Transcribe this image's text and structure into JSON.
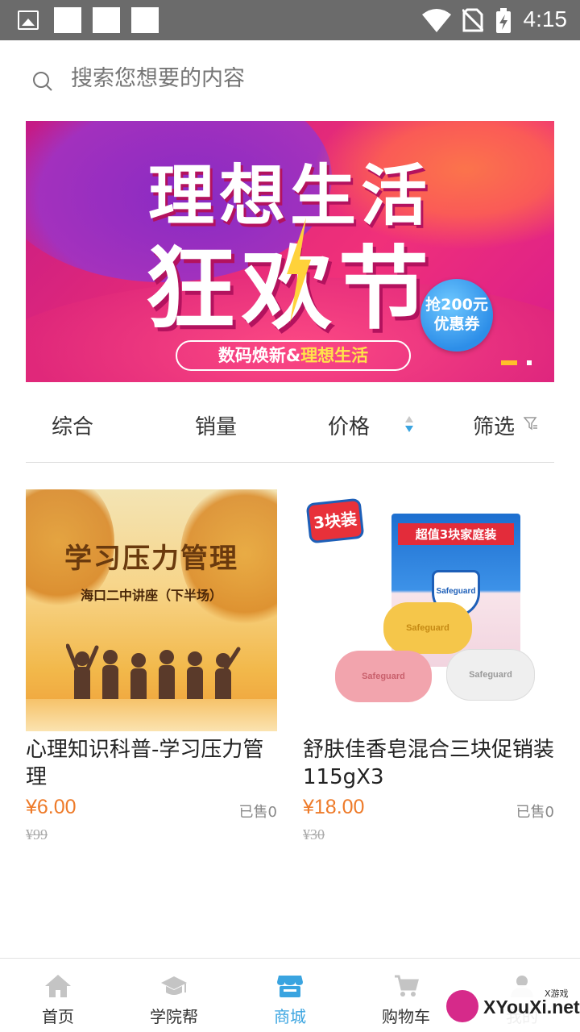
{
  "status_bar": {
    "time": "4:15"
  },
  "search": {
    "placeholder": "搜索您想要的内容"
  },
  "banner": {
    "title_line1": "理想生活",
    "title_line2": "狂欢节",
    "coupon": "抢200元 优惠券",
    "subtitle_prefix": "数码焕新&",
    "subtitle_highlight": "理想生活"
  },
  "sort": {
    "items": [
      {
        "label": "综合"
      },
      {
        "label": "销量"
      },
      {
        "label": "价格"
      },
      {
        "label": "筛选"
      }
    ]
  },
  "products": [
    {
      "image_title": "学习压力管理",
      "image_subtitle": "海口二中讲座（下半场）",
      "name": "心理知识科普-学习压力管理",
      "price": "¥6.00",
      "sold": "已售0",
      "original_price": "¥99"
    },
    {
      "image_badge": "3块装",
      "image_box_label": "超值3块家庭装",
      "image_brand": "Safeguard",
      "name": "舒肤佳香皂混合三块促销装115gX3",
      "price": "¥18.00",
      "sold": "已售0",
      "original_price": "¥30"
    }
  ],
  "bottom_nav": {
    "items": [
      {
        "label": "首页",
        "icon": "home-icon"
      },
      {
        "label": "学院帮",
        "icon": "graduation-cap-icon"
      },
      {
        "label": "商城",
        "icon": "store-icon",
        "active": true
      },
      {
        "label": "购物车",
        "icon": "cart-icon"
      },
      {
        "label": "我的",
        "icon": "user-icon"
      }
    ]
  },
  "watermark": {
    "text": "XYouXi.net",
    "small": "X游戏"
  },
  "colors": {
    "accent": "#3aa4e0",
    "price": "#ee7b2a",
    "status_bar": "#6b6b6b"
  }
}
